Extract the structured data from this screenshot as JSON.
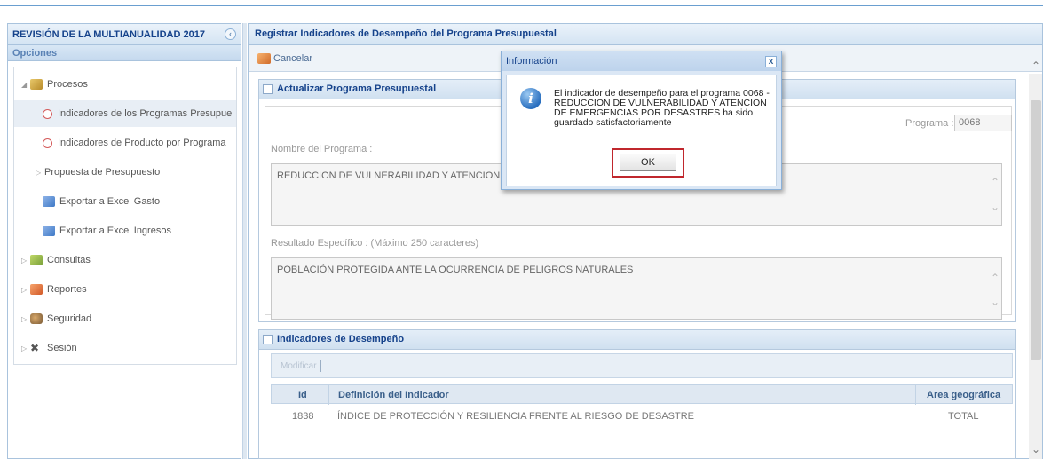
{
  "left_panel": {
    "title": "REVISIÓN DE LA MULTIANUALIDAD 2017",
    "options_label": "Opciones",
    "tree": [
      {
        "label": "Procesos"
      },
      {
        "label": "Indicadores de los Programas Presupue"
      },
      {
        "label": "Indicadores de Producto por Programa"
      },
      {
        "label": "Propuesta de Presupuesto"
      },
      {
        "label": "Exportar a Excel Gasto"
      },
      {
        "label": "Exportar a Excel Ingresos"
      },
      {
        "label": "Consultas"
      },
      {
        "label": "Reportes"
      },
      {
        "label": "Seguridad"
      },
      {
        "label": "Sesión"
      }
    ]
  },
  "main": {
    "title": "Registrar Indicadores de Desempeño del Programa Presupuestal",
    "cancel_label": "Cancelar",
    "section_update": {
      "title": "Actualizar Programa Presupuestal",
      "programa_label": "Programa :",
      "programa_value": "0068",
      "nombre_label": "Nombre del Programa :",
      "nombre_value": "REDUCCION DE VULNERABILIDAD Y ATENCION D",
      "resultado_label": "Resultado Específico : (Máximo 250 caracteres)",
      "resultado_value": "POBLACIÓN PROTEGIDA ANTE LA OCURRENCIA DE PELIGROS NATURALES"
    },
    "section_indicadores": {
      "title": "Indicadores de Desempeño",
      "modificar_label": "Modificar",
      "columns": [
        "Id",
        "Definición del Indicador",
        "Area geográfica"
      ],
      "rows": [
        {
          "id": "1838",
          "definicion": "ÍNDICE DE PROTECCIÓN Y RESILIENCIA FRENTE AL RIESGO DE DESASTRE",
          "area": "TOTAL"
        }
      ]
    }
  },
  "modal": {
    "title": "Información",
    "message": "El indicador de desempeño para el programa 0068 - REDUCCION DE VULNERABILIDAD Y ATENCION DE EMERGENCIAS POR DESASTRES ha sido guardado satisfactoriamente",
    "ok_label": "OK",
    "close_glyph": "x"
  }
}
